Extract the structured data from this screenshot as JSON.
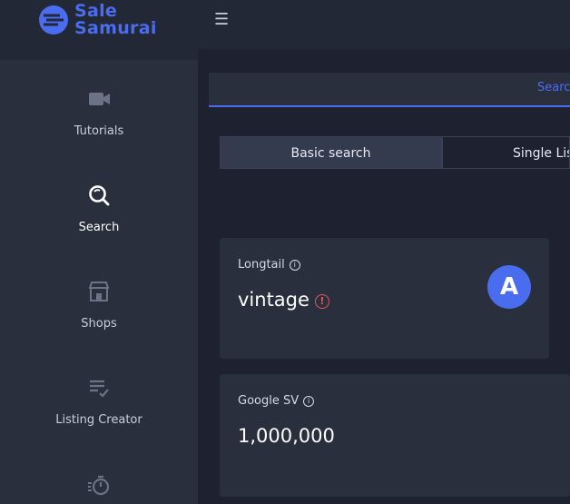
{
  "app": {
    "logo_line1": "Sale",
    "logo_line2": "Samurai",
    "accent": "#4a6df0"
  },
  "sidebar": {
    "items": [
      {
        "label": "Tutorials",
        "icon": "video-camera-icon"
      },
      {
        "label": "Search",
        "icon": "search-icon",
        "active": true
      },
      {
        "label": "Shops",
        "icon": "shop-icon"
      },
      {
        "label": "Listing Creator",
        "icon": "checklist-icon"
      },
      {
        "label": "",
        "icon": "stopwatch-icon"
      }
    ]
  },
  "topbar": {
    "menu_icon": "hamburger-icon"
  },
  "tabs": {
    "active_label": "Search"
  },
  "search_modes": {
    "basic": "Basic search",
    "single": "Single Listing"
  },
  "cards": {
    "longtail": {
      "title": "Longtail",
      "value": "vintage",
      "grade": "A",
      "warning_icon": "warning-icon",
      "info_icon": "info-icon"
    },
    "google_sv": {
      "title": "Google SV",
      "value": "1,000,000",
      "info_icon": "info-icon"
    }
  }
}
